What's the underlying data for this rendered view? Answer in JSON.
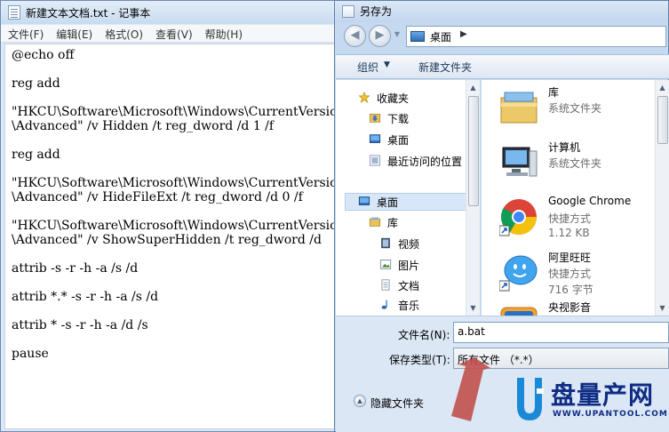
{
  "notepad": {
    "title": "新建文本文档.txt - 记事本",
    "menu": [
      "文件(F)",
      "编辑(E)",
      "格式(O)",
      "查看(V)",
      "帮助(H)"
    ],
    "lines": [
      "@echo off",
      "",
      "reg add",
      "",
      "\"HKCU\\Software\\Microsoft\\Windows\\CurrentVersio",
      "\\Advanced\" /v Hidden /t reg_dword /d 1 /f",
      "",
      "reg add",
      "",
      "\"HKCU\\Software\\Microsoft\\Windows\\CurrentVersio",
      "\\Advanced\" /v HideFileExt /t reg_dword /d 0 /f",
      "",
      "\"HKCU\\Software\\Microsoft\\Windows\\CurrentVersio",
      "\\Advanced\" /v ShowSuperHidden /t reg_dword /d",
      "",
      "attrib -s -r -h -a /s /d",
      "",
      "attrib *.* -s -r -h -a /s /d",
      "",
      "attrib * -s -r -h -a /d /s",
      "",
      "pause"
    ]
  },
  "dialog": {
    "title": "另存为",
    "address": "桌面",
    "toolbar": {
      "organize": "组织",
      "new_folder": "新建文件夹"
    },
    "nav_items": [
      {
        "label": "收藏夹",
        "icon": "star-icon"
      },
      {
        "label": "下载",
        "icon": "download-folder-icon"
      },
      {
        "label": "桌面",
        "icon": "desktop-icon"
      },
      {
        "label": "最近访问的位置",
        "icon": "recent-places-icon"
      },
      {
        "label": "桌面",
        "icon": "desktop-icon"
      },
      {
        "label": "库",
        "icon": "library-icon"
      },
      {
        "label": "视频",
        "icon": "video-icon"
      },
      {
        "label": "图片",
        "icon": "picture-icon"
      },
      {
        "label": "文档",
        "icon": "document-icon"
      },
      {
        "label": "音乐",
        "icon": "music-icon"
      }
    ],
    "files": [
      {
        "name": "库",
        "type": "系统文件夹",
        "size": "",
        "icon": "library-folder-icon"
      },
      {
        "name": "计算机",
        "type": "系统文件夹",
        "size": "",
        "icon": "computer-icon"
      },
      {
        "name": "Google Chrome",
        "type": "快捷方式",
        "size": "1.12 KB",
        "icon": "chrome-icon"
      },
      {
        "name": "阿里旺旺",
        "type": "快捷方式",
        "size": "716 字节",
        "icon": "aliwangwang-icon"
      },
      {
        "name": "央视影音",
        "type": "",
        "size": "",
        "icon": "cntv-icon"
      }
    ],
    "filename_label": "文件名(N):",
    "filename_value": "a.bat",
    "filetype_label": "保存类型(T):",
    "filetype_value": "所有文件 （*.*）",
    "hide_folders_label": "隐藏文件夹"
  },
  "watermark": {
    "text": "盘量产网",
    "url": "WWW.UPANTOOL.COM"
  },
  "colors": {
    "accent": "#3c6eb4",
    "annotation_arrow": "#c0504d",
    "watermark": "#0f2c85"
  }
}
